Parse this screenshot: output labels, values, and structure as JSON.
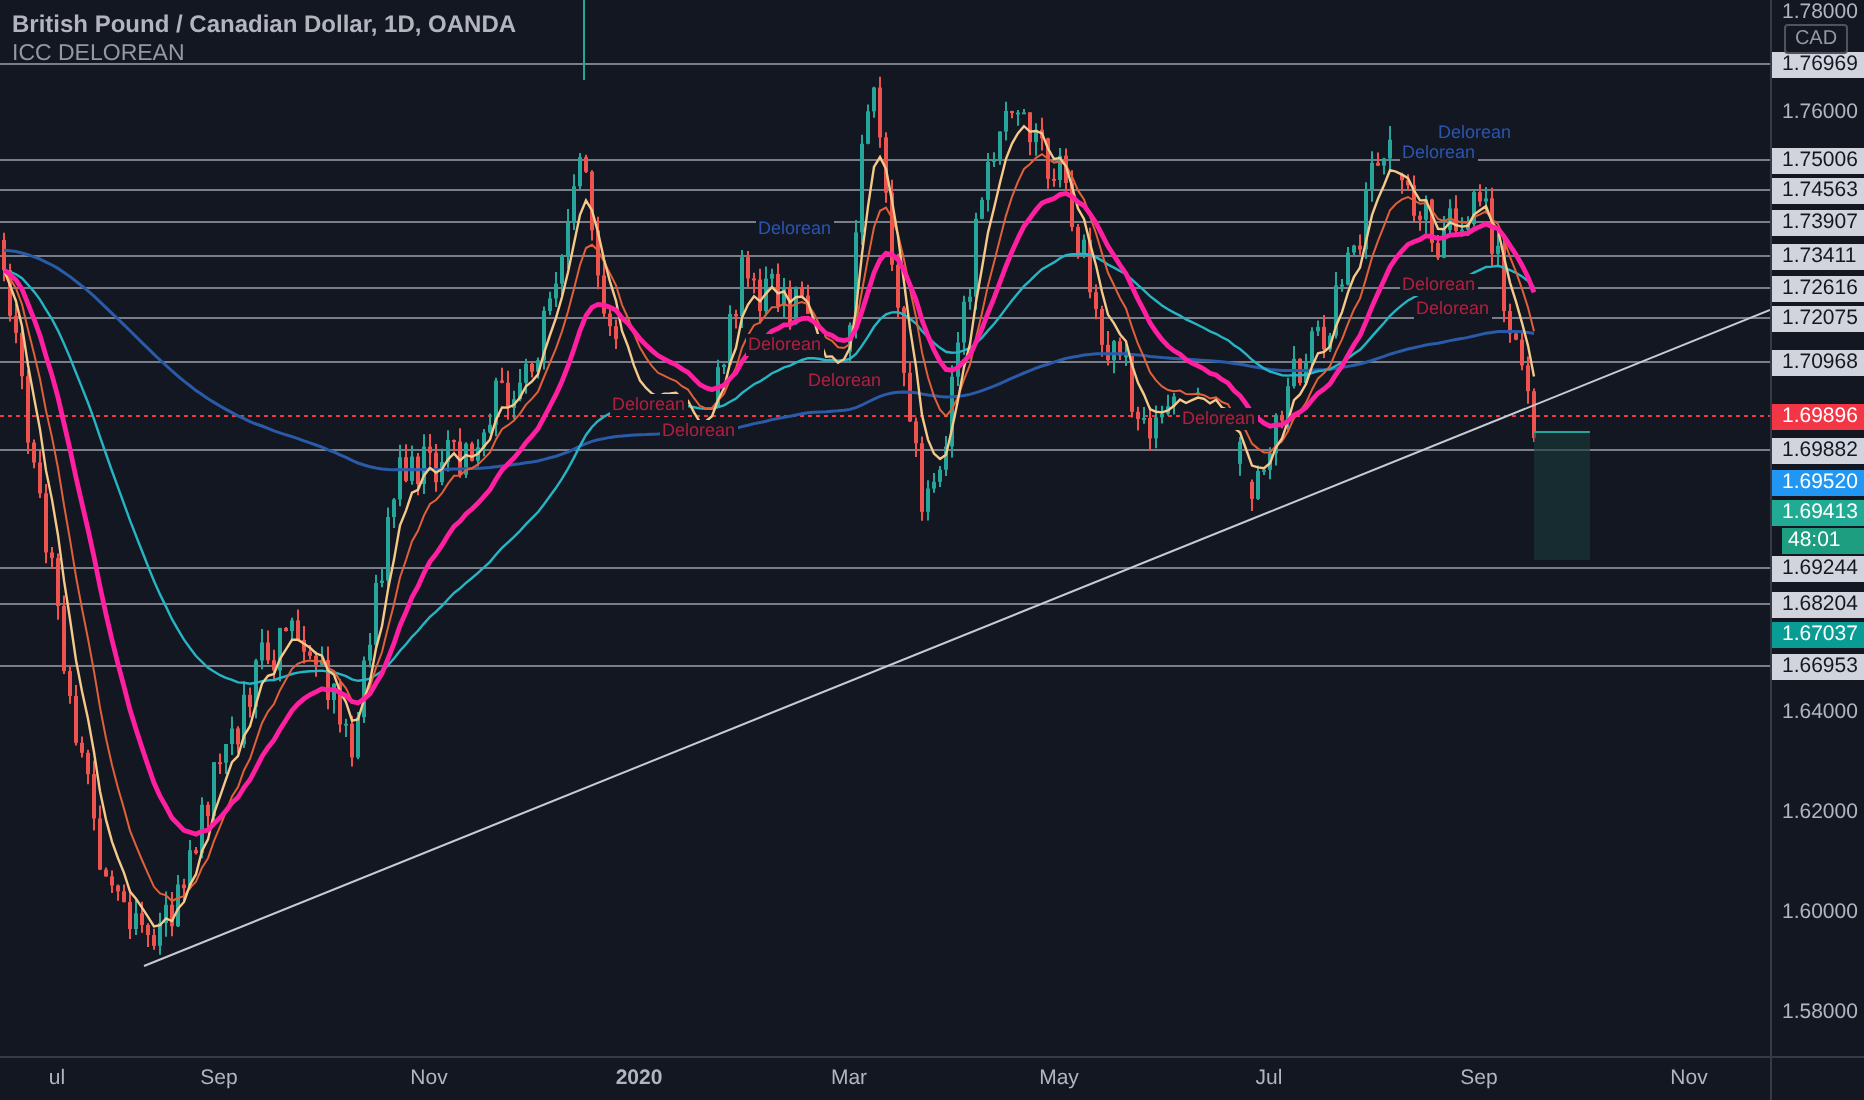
{
  "legend": {
    "title": "British Pound / Canadian Dollar, 1D, OANDA",
    "indicator": "ICC DELOREAN"
  },
  "price_axis": {
    "currency": "CAD",
    "labels": [
      {
        "text": "1.78000",
        "kind": "tick"
      },
      {
        "text": "1.76969",
        "kind": "tag"
      },
      {
        "text": "1.76000",
        "kind": "tick"
      },
      {
        "text": "1.75006",
        "kind": "tag"
      },
      {
        "text": "1.74563",
        "kind": "tag"
      },
      {
        "text": "1.73907",
        "kind": "tag"
      },
      {
        "text": "1.73411",
        "kind": "tag"
      },
      {
        "text": "1.72616",
        "kind": "tag"
      },
      {
        "text": "1.72075",
        "kind": "tag"
      },
      {
        "text": "1.70968",
        "kind": "tag"
      },
      {
        "text": "1.69896",
        "kind": "mark",
        "color": "#f23645"
      },
      {
        "text": "1.69882",
        "kind": "tag"
      },
      {
        "text": "1.69520",
        "kind": "mark",
        "color": "#2196f3"
      },
      {
        "text": "1.69413",
        "kind": "mark",
        "color": "#22ab94"
      },
      {
        "text": "48:01",
        "kind": "mark",
        "color": "#1e9e80"
      },
      {
        "text": "1.69244",
        "kind": "tag"
      },
      {
        "text": "1.68204",
        "kind": "tag"
      },
      {
        "text": "1.67037",
        "kind": "mark",
        "color": "#089c94"
      },
      {
        "text": "1.66953",
        "kind": "tag"
      },
      {
        "text": "1.64000",
        "kind": "tick"
      },
      {
        "text": "1.62000",
        "kind": "tick"
      },
      {
        "text": "1.60000",
        "kind": "tick"
      },
      {
        "text": "1.58000",
        "kind": "tick"
      }
    ]
  },
  "signals": [
    {
      "text": "Delorean",
      "kind": "buy"
    },
    {
      "text": "Delorean",
      "kind": "buy"
    },
    {
      "text": "Delorean",
      "kind": "buy"
    },
    {
      "text": "Delorean",
      "kind": "sell"
    },
    {
      "text": "Delorean",
      "kind": "sell"
    },
    {
      "text": "Delorean",
      "kind": "sell"
    },
    {
      "text": "Delorean",
      "kind": "sell"
    },
    {
      "text": "Delorean",
      "kind": "sell"
    },
    {
      "text": "Delorean",
      "kind": "sell"
    },
    {
      "text": "Delorean",
      "kind": "sell"
    }
  ],
  "time_axis": {
    "labels": [
      {
        "text": "ul",
        "kind": "month"
      },
      {
        "text": "Sep",
        "kind": "month"
      },
      {
        "text": "Nov",
        "kind": "month"
      },
      {
        "text": "2020",
        "kind": "year"
      },
      {
        "text": "Mar",
        "kind": "month"
      },
      {
        "text": "May",
        "kind": "month"
      },
      {
        "text": "Jul",
        "kind": "month"
      },
      {
        "text": "Sep",
        "kind": "month"
      },
      {
        "text": "Nov",
        "kind": "month"
      }
    ]
  }
}
